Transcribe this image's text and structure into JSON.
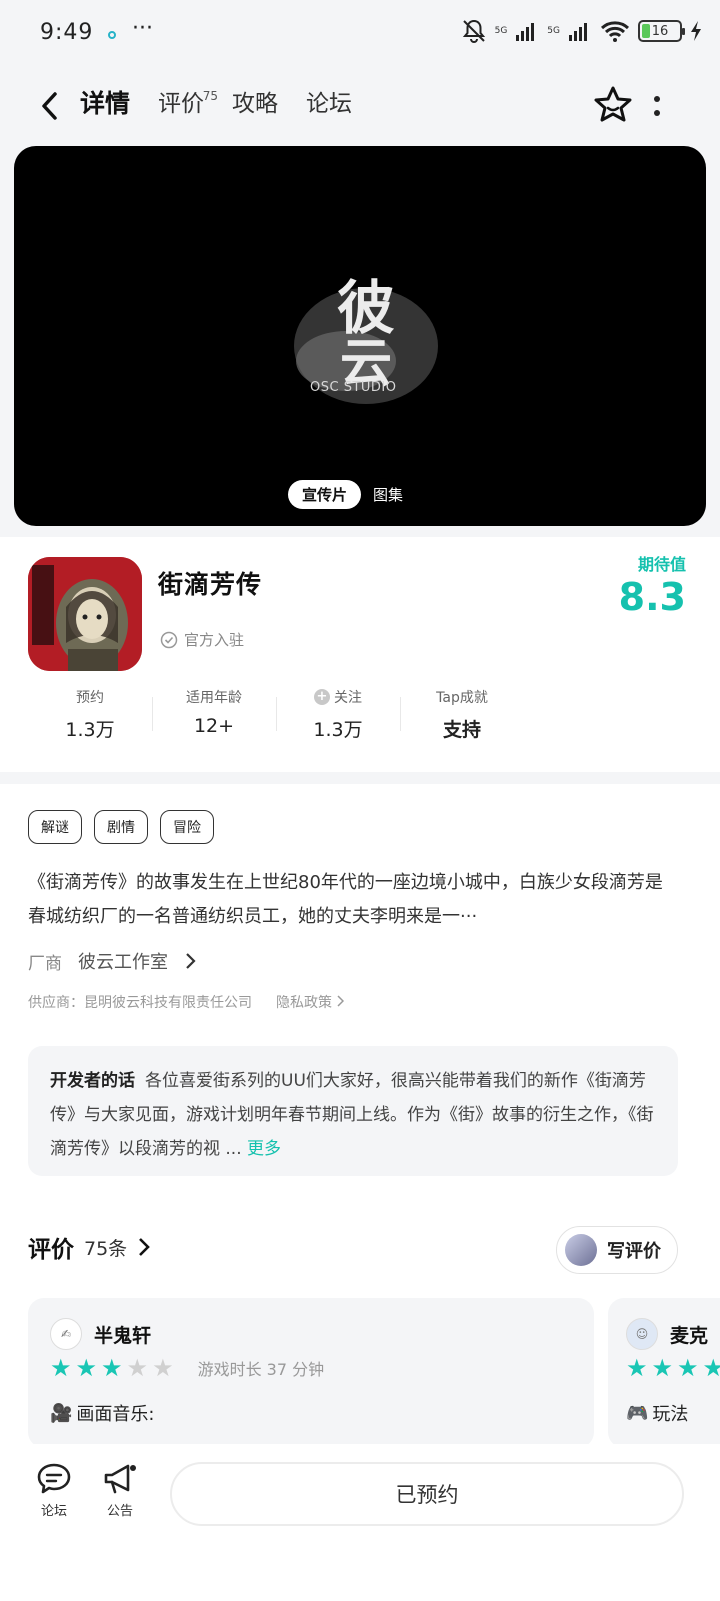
{
  "status_bar": {
    "time": "9:49",
    "more": "···",
    "battery": "16",
    "network_1": "5G",
    "network_2": "5G"
  },
  "nav": {
    "tabs": [
      {
        "label": "详情",
        "badge": ""
      },
      {
        "label": "评价",
        "badge": "75"
      },
      {
        "label": "攻略",
        "badge": ""
      },
      {
        "label": "论坛",
        "badge": ""
      }
    ]
  },
  "media": {
    "logo_subtitle": "OSC STUDIO",
    "logo_chars": "彼云",
    "switch": [
      "宣传片",
      "图集"
    ]
  },
  "game": {
    "title": "街滴芳传",
    "official_label": "官方入驻",
    "expect_label": "期待值",
    "expect_value": "8.3",
    "stats": [
      {
        "label": "预约",
        "value": "1.3万"
      },
      {
        "label": "适用年龄",
        "value": "12+"
      },
      {
        "label": "关注",
        "value": "1.3万"
      },
      {
        "label": "Tap成就",
        "value": "支持"
      }
    ]
  },
  "tags": [
    "解谜",
    "剧情",
    "冒险"
  ],
  "description": "《街滴芳传》的故事发生在上世纪80年代的一座边境小城中，白族少女段滴芳是春城纺织厂的一名普通纺织员工，她的丈夫李明来是一···",
  "vendor": {
    "label": "厂商",
    "name": "彼云工作室"
  },
  "supplier": {
    "text": "供应商：昆明彼云科技有限责任公司",
    "privacy": "隐私政策"
  },
  "dev_note": {
    "lead": "开发者的话",
    "body": "各位喜爱街系列的UU们大家好，很高兴能带着我们的新作《街滴芳传》与大家见面，游戏计划明年春节期间上线。作为《街》故事的衍生之作，《街滴芳传》以段滴芳的视 ...",
    "more": "更多"
  },
  "reviews": {
    "title": "评价",
    "count": "75条",
    "write_label": "写评价",
    "items": [
      {
        "name": "半鬼轩",
        "rating": 3,
        "play_time": "游戏时长 37 分钟",
        "line": "画面音乐:"
      },
      {
        "name": "麦克",
        "rating": 5,
        "play_time": "",
        "line": "玩法"
      }
    ]
  },
  "bottom": {
    "forum": "论坛",
    "notice": "公告",
    "reserve": "已预约"
  },
  "colors": {
    "accent": "#15c1ae",
    "background": "#f4f5f7"
  }
}
